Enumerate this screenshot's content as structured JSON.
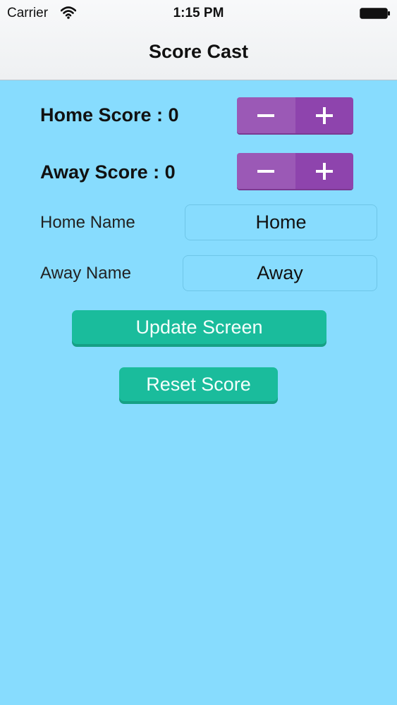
{
  "status_bar": {
    "carrier": "Carrier",
    "time": "1:15 PM",
    "icons": [
      "wifi-icon",
      "battery-icon"
    ]
  },
  "nav": {
    "title": "Score Cast"
  },
  "home_score": {
    "label": "Home Score : 0"
  },
  "away_score": {
    "label": "Away Score : 0"
  },
  "stepper": {
    "minus_icon": "minus-icon",
    "plus_icon": "plus-icon"
  },
  "home_name": {
    "label": "Home Name",
    "value": "Home"
  },
  "away_name": {
    "label": "Away Name",
    "value": "Away"
  },
  "buttons": {
    "update": "Update Screen",
    "reset": "Reset Score"
  },
  "colors": {
    "background": "#87dcfe",
    "stepper_minus": "#9b59b6",
    "stepper_plus": "#8e44ad",
    "button": "#1abc9c"
  }
}
